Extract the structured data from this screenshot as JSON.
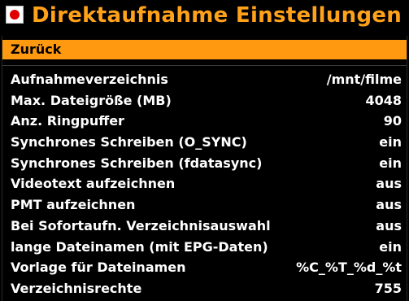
{
  "header": {
    "icon": "record-icon",
    "title": "Direktaufnahme Einstellungen",
    "title_color": "#ffa21a"
  },
  "menu": {
    "back_label": "Zurück",
    "selected_color": "#ff9a10",
    "items": [
      {
        "label": "Aufnahmeverzeichnis",
        "value": "/mnt/filme"
      },
      {
        "label": "Max. Dateigröße (MB)",
        "value": "4048"
      },
      {
        "label": "Anz. Ringpuffer",
        "value": "90"
      },
      {
        "label": "Synchrones Schreiben (O_SYNC)",
        "value": "ein"
      },
      {
        "label": "Synchrones Schreiben (fdatasync)",
        "value": "ein"
      },
      {
        "label": "Videotext aufzeichnen",
        "value": "aus"
      },
      {
        "label": "PMT aufzeichnen",
        "value": "aus"
      },
      {
        "label": "Bei Sofortaufn. Verzeichnisauswahl",
        "value": "aus"
      },
      {
        "label": "lange Dateinamen (mit EPG-Daten)",
        "value": "ein"
      },
      {
        "label": "Vorlage für Dateinamen",
        "value": "%C_%T_%d_%t"
      },
      {
        "label": "Verzeichnisrechte",
        "value": "755"
      }
    ]
  }
}
